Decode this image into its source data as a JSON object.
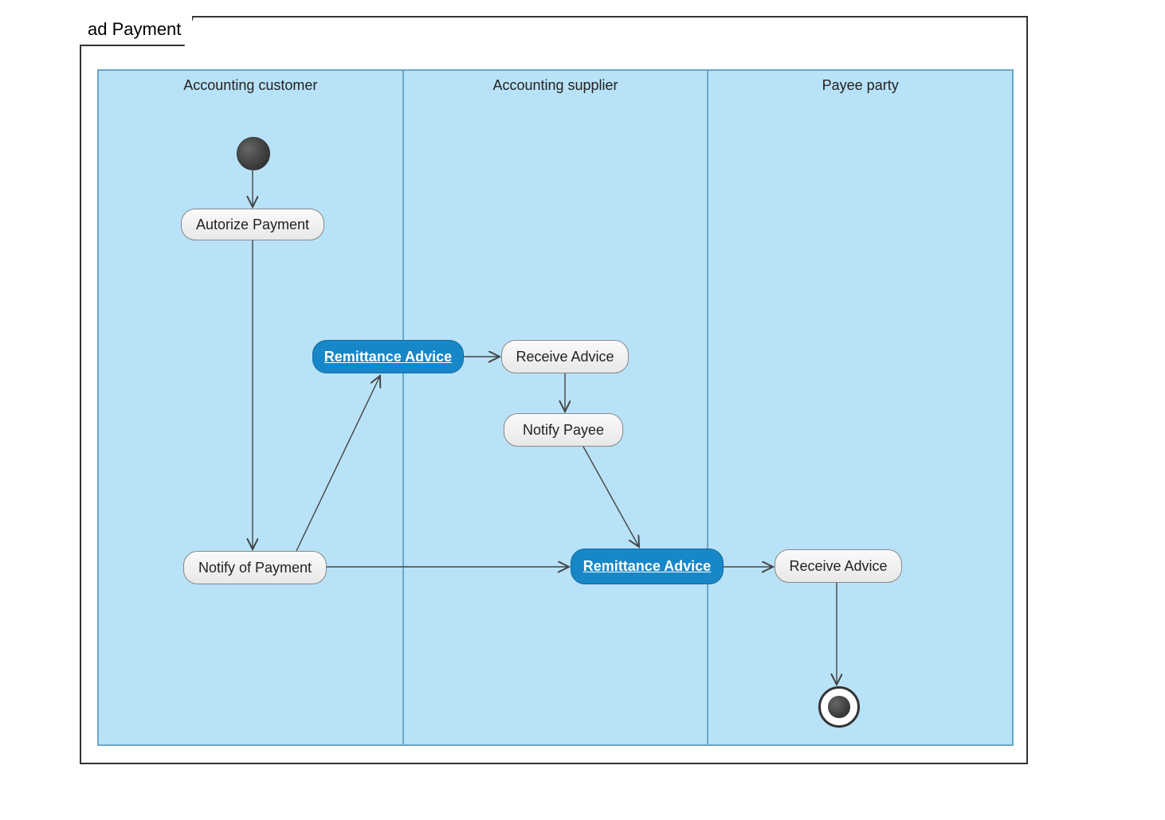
{
  "frame": {
    "label": "ad Payment"
  },
  "lanes": [
    {
      "title": "Accounting customer"
    },
    {
      "title": "Accounting supplier"
    },
    {
      "title": "Payee party"
    }
  ],
  "nodes": {
    "authorize": {
      "label": "Autorize Payment"
    },
    "remit1": {
      "label": "Remittance Advice"
    },
    "receive1": {
      "label": "Receive Advice"
    },
    "notifyPayee": {
      "label": "Notify Payee"
    },
    "notifyOfPayment": {
      "label": "Notify of Payment"
    },
    "remit2": {
      "label": "Remittance Advice"
    },
    "receive2": {
      "label": "Receive Advice"
    }
  },
  "chart_data": {
    "type": "uml-activity",
    "title": "ad Payment",
    "swimlanes": [
      "Accounting customer",
      "Accounting supplier",
      "Payee party"
    ],
    "activities": [
      {
        "id": "start",
        "kind": "initial",
        "lane": "Accounting customer"
      },
      {
        "id": "authorize",
        "kind": "action",
        "lane": "Accounting customer",
        "label": "Autorize Payment"
      },
      {
        "id": "remit1",
        "kind": "object",
        "lane": "Accounting customer",
        "label": "Remittance Advice"
      },
      {
        "id": "receive1",
        "kind": "action",
        "lane": "Accounting supplier",
        "label": "Receive Advice"
      },
      {
        "id": "notifyPayee",
        "kind": "action",
        "lane": "Accounting supplier",
        "label": "Notify Payee"
      },
      {
        "id": "notifyOfPayment",
        "kind": "action",
        "lane": "Accounting customer",
        "label": "Notify of Payment"
      },
      {
        "id": "remit2",
        "kind": "object",
        "lane": "Accounting supplier",
        "label": "Remittance Advice"
      },
      {
        "id": "receive2",
        "kind": "action",
        "lane": "Payee party",
        "label": "Receive Advice"
      },
      {
        "id": "end",
        "kind": "final",
        "lane": "Payee party"
      }
    ],
    "flows": [
      {
        "from": "start",
        "to": "authorize"
      },
      {
        "from": "authorize",
        "to": "notifyOfPayment"
      },
      {
        "from": "notifyOfPayment",
        "to": "remit1"
      },
      {
        "from": "remit1",
        "to": "receive1"
      },
      {
        "from": "receive1",
        "to": "notifyPayee"
      },
      {
        "from": "notifyPayee",
        "to": "remit2"
      },
      {
        "from": "notifyOfPayment",
        "to": "remit2"
      },
      {
        "from": "remit2",
        "to": "receive2"
      },
      {
        "from": "receive2",
        "to": "end"
      }
    ]
  }
}
